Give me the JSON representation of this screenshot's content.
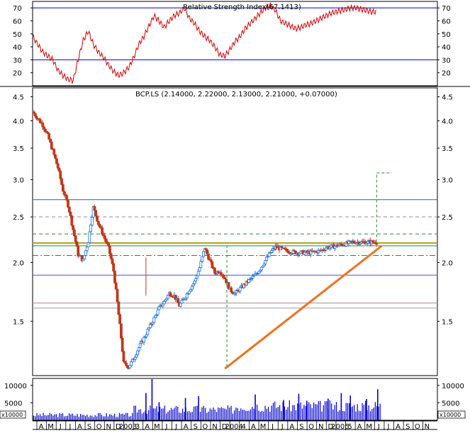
{
  "chart_data": [
    {
      "type": "line",
      "title": "Relative Strength Index(67.1413)",
      "ylim": [
        10,
        75
      ],
      "y_ticks": [
        "20",
        "30",
        "40",
        "50",
        "60",
        "70"
      ],
      "reference_lines": [
        {
          "value": 70,
          "color": "#0000cc"
        },
        {
          "value": 30,
          "color": "#0000cc"
        }
      ],
      "series": [
        {
          "color": "#cc0000",
          "x": [
            0.0,
            0.5,
            1.0,
            1.5,
            2.0,
            2.5,
            3.0,
            3.5,
            4.0,
            4.5,
            5.0,
            5.5,
            6.0,
            6.5,
            7.0,
            7.5,
            8.0,
            8.5,
            9.0,
            9.5,
            10.0,
            10.5,
            11.0,
            11.5,
            12.0,
            12.5,
            13.0,
            13.5,
            14.0,
            14.5,
            15.0,
            15.5,
            16.0,
            16.5,
            17.0,
            17.5,
            18.0,
            18.5,
            19.0,
            19.5,
            20.0,
            20.5,
            21.0,
            21.5,
            22.0,
            22.5,
            23.0,
            23.5,
            24.0,
            24.5,
            25.0,
            25.5,
            26.0,
            26.5,
            27.0,
            27.5,
            28.0,
            28.5,
            29.0,
            29.5,
            30.0,
            30.5,
            31.0,
            31.5,
            32.0,
            32.5,
            33.0,
            33.5,
            34.0
          ],
          "y": [
            48,
            42,
            36,
            33,
            30,
            22,
            18,
            15,
            14,
            30,
            45,
            52,
            42,
            36,
            32,
            26,
            21,
            18,
            20,
            24,
            32,
            42,
            48,
            56,
            64,
            60,
            55,
            60,
            64,
            66,
            70,
            62,
            58,
            52,
            48,
            45,
            40,
            34,
            33,
            38,
            44,
            48,
            54,
            58,
            62,
            66,
            70,
            72,
            68,
            60,
            58,
            56,
            54,
            55,
            57,
            58,
            60,
            62,
            64,
            66,
            67,
            68,
            69,
            70,
            70,
            69,
            68,
            67,
            67
          ]
        }
      ]
    },
    {
      "type": "candlestick",
      "title": "BCP.LS (2.14000, 2.22000, 2.13000, 2.21000, +0.07000)",
      "ylim": [
        1.15,
        4.7
      ],
      "log_scale": true,
      "y_ticks": [
        "1.5",
        "2.0",
        "2.5",
        "3.0",
        "3.5",
        "4.0",
        "4.5"
      ],
      "up_color": "#1a6fd6",
      "down_color": "#c0391b",
      "close_series": {
        "x": [
          0.0,
          0.5,
          1.0,
          1.5,
          2.0,
          2.5,
          3.0,
          3.5,
          4.0,
          4.5,
          5.0,
          5.5,
          6.0,
          6.5,
          7.0,
          7.5,
          8.0,
          8.5,
          9.0,
          9.5,
          10.0,
          10.5,
          11.0,
          11.5,
          12.0,
          12.5,
          13.0,
          13.5,
          14.0,
          14.5,
          15.0,
          15.5,
          16.0,
          16.5,
          17.0,
          17.5,
          18.0,
          18.5,
          19.0,
          19.5,
          20.0,
          20.5,
          21.0,
          21.5,
          22.0,
          22.5,
          23.0,
          23.5,
          24.0,
          24.5,
          25.0,
          25.5,
          26.0,
          26.5,
          27.0,
          27.5,
          28.0,
          28.5,
          29.0,
          29.5,
          30.0,
          30.5,
          31.0,
          31.5,
          32.0,
          32.5,
          33.0,
          33.5,
          34.0
        ],
        "y": [
          4.18,
          4.05,
          3.92,
          3.72,
          3.45,
          3.18,
          2.85,
          2.65,
          2.35,
          2.08,
          2.02,
          2.22,
          2.62,
          2.42,
          2.28,
          2.15,
          1.92,
          1.55,
          1.22,
          1.2,
          1.25,
          1.32,
          1.38,
          1.45,
          1.52,
          1.6,
          1.65,
          1.72,
          1.7,
          1.62,
          1.68,
          1.75,
          1.82,
          1.95,
          2.15,
          2.02,
          1.9,
          1.92,
          1.85,
          1.75,
          1.72,
          1.76,
          1.8,
          1.84,
          1.88,
          1.94,
          2.02,
          2.1,
          2.16,
          2.14,
          2.12,
          2.11,
          2.1,
          2.1,
          2.1,
          2.1,
          2.11,
          2.12,
          2.15,
          2.16,
          2.17,
          2.18,
          2.19,
          2.21,
          2.21,
          2.21,
          2.21,
          2.21,
          2.21
        ]
      },
      "horizontal_lines": [
        {
          "value": 2.72,
          "color": "#3a5a9a",
          "style": "solid"
        },
        {
          "value": 2.5,
          "color": "#8888cc",
          "style": "dashed"
        },
        {
          "value": 2.3,
          "color": "#2a8a2a",
          "style": "dashed"
        },
        {
          "value": 2.2,
          "color": "#b0a020",
          "style": "solid"
        },
        {
          "value": 2.17,
          "color": "#2a8a2a",
          "style": "solid"
        },
        {
          "value": 2.07,
          "color": "#2a8a2a",
          "style": "dashdot"
        },
        {
          "value": 1.88,
          "color": "#4455dd",
          "style": "solid"
        },
        {
          "value": 1.64,
          "color": "#b08888",
          "style": "solid"
        },
        {
          "value": 1.6,
          "color": "#9aa0aa",
          "style": "solid"
        }
      ],
      "trendline": {
        "x": [
          19.0,
          34.5
        ],
        "y": [
          1.19,
          2.17
        ],
        "color": "#f07020"
      },
      "vertical_markers": [
        {
          "x": 19.2,
          "from": 1.2,
          "to": 2.17,
          "color": "#2a8a2a"
        },
        {
          "x": 34.0,
          "from": 2.21,
          "to": 3.1,
          "color": "#2a8a2a"
        }
      ],
      "target_tick": {
        "x_from": 34.0,
        "x_to": 35.5,
        "y": 3.1,
        "color": "#2a8a2a"
      }
    },
    {
      "type": "bar",
      "y_ticks": [
        "5000",
        "10000"
      ],
      "ylim": [
        0,
        12000
      ],
      "axis_unit_label": "x10000",
      "color": "#0000cc",
      "x_month_labels": [
        "A",
        "M",
        "J",
        "J",
        "A",
        "S",
        "O",
        "N",
        "D",
        "2003",
        "M",
        "A",
        "M",
        "J",
        "J",
        "A",
        "S",
        "O",
        "N",
        "D",
        "2004",
        "F",
        "M",
        "A",
        "M",
        "J",
        "J",
        "A",
        "S",
        "O",
        "N",
        "D",
        "2005",
        "F",
        "M",
        "A",
        "M",
        "J",
        "J",
        "A",
        "S",
        "O",
        "N"
      ],
      "x_month_ticks": [
        "A",
        "M",
        "J",
        "J",
        "A",
        "S",
        "O",
        "N",
        "D",
        "2003",
        "3",
        "A",
        "M",
        "J",
        "J",
        "A",
        "S",
        "O",
        "N",
        "D",
        "2004",
        "4",
        "A",
        "M",
        "J",
        "J",
        "A",
        "S",
        "O",
        "N",
        "D",
        "2005",
        "5",
        "A",
        "M",
        "J",
        "J",
        "A",
        "S",
        "O",
        "N"
      ],
      "spikes": [
        {
          "x": 11.8,
          "value": 11800
        },
        {
          "x": 11.2,
          "value": 7800
        },
        {
          "x": 12.5,
          "value": 5200
        },
        {
          "x": 15.1,
          "value": 6400
        },
        {
          "x": 16.4,
          "value": 6900
        },
        {
          "x": 22.0,
          "value": 7400
        },
        {
          "x": 24.8,
          "value": 5800
        },
        {
          "x": 26.3,
          "value": 7600
        },
        {
          "x": 27.1,
          "value": 5600
        },
        {
          "x": 29.2,
          "value": 6200
        },
        {
          "x": 30.5,
          "value": 7800
        },
        {
          "x": 31.4,
          "value": 7100
        },
        {
          "x": 33.0,
          "value": 6100
        },
        {
          "x": 34.1,
          "value": 8900
        }
      ]
    }
  ],
  "x_axis": {
    "labels": [
      "A",
      "M",
      "J",
      "J",
      "A",
      "S",
      "O",
      "N",
      "D",
      "2003",
      "M",
      "A",
      "M",
      "J",
      "J",
      "A",
      "S",
      "O",
      "N",
      "D",
      "2004",
      "F",
      "M",
      "A",
      "M",
      "J",
      "J",
      "A",
      "S",
      "O",
      "N",
      "D",
      "2005",
      "F",
      "M",
      "A",
      "M",
      "J",
      "J",
      "A",
      "S",
      "O",
      "N"
    ]
  },
  "x_axis_printed": {
    "labels": [
      "A",
      "M",
      "J",
      "J",
      "A",
      "S",
      "O",
      "N",
      "D",
      "2003",
      "3",
      "A",
      "M",
      "J",
      "J",
      "A",
      "S",
      "O",
      "N",
      "D",
      "2004",
      "4",
      "A",
      "M",
      "J",
      "J",
      "A",
      "S",
      "O",
      "N",
      "D",
      "2005",
      "5",
      "A",
      "M",
      "J",
      "J",
      "A",
      "S",
      "O",
      "N"
    ]
  },
  "colors": {
    "axis": "#000000",
    "background": "#ffffff"
  }
}
